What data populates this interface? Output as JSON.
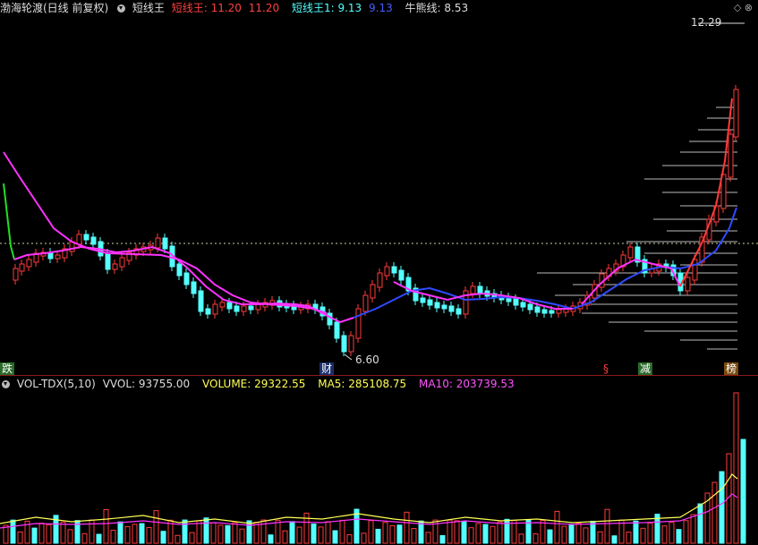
{
  "main_header": {
    "stock_name": "渤海轮渡(日线 前复权)",
    "indicator": "短线王",
    "line1_label": "短线王:",
    "line1_value": "11.20",
    "line1_alt": "11.20",
    "line2_label": "短线王1:",
    "line2_value": "9.13",
    "line2_alt": "9.13",
    "line3_label": "牛熊线:",
    "line3_value": "8.53"
  },
  "price_marks": {
    "high_label": "12.29",
    "low_label": "6.60"
  },
  "markers": {
    "left": "跌",
    "caiwu": "财",
    "red_s": "§",
    "jian": "减",
    "bang": "榜"
  },
  "volume_header": {
    "indicator": "VOL-TDX(5,10)",
    "vvol_label": "VVOL:",
    "vvol_value": "93755.00",
    "volume_label": "VOLUME:",
    "volume_value": "29322.55",
    "ma5_label": "MA5:",
    "ma5_value": "285108.75",
    "ma10_label": "MA10:",
    "ma10_value": "203739.53"
  },
  "colors": {
    "up": "#ff3b3b",
    "down": "#54ffff",
    "magenta": "#ff33ff",
    "blue": "#2f4bff",
    "green": "#22dd22",
    "yellow": "#ffff55",
    "white_line": "#cccccc"
  }
}
